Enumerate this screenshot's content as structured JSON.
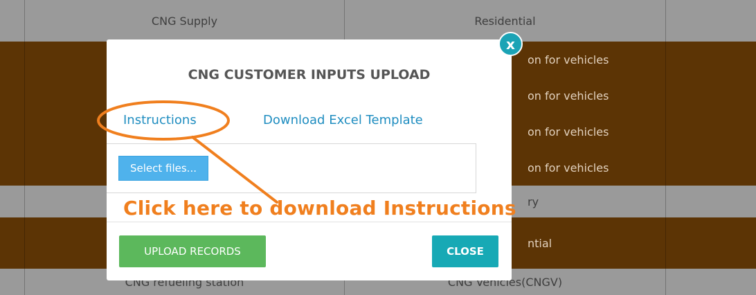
{
  "background_table": {
    "row1": {
      "col1": "CNG Supply",
      "col2": "Residential"
    },
    "row2": {
      "col2_lines": [
        "on for vehicles",
        "on for vehicles",
        "on for vehicles",
        "on for vehicles"
      ]
    },
    "row3": {
      "col2": "ry"
    },
    "row4": {
      "col2": "ntial"
    },
    "row5": {
      "col1": "CNG refueling station",
      "col2": "CNG Vehicles(CNGV)"
    }
  },
  "modal": {
    "title": "CNG CUSTOMER INPUTS UPLOAD",
    "instructions_link": "Instructions",
    "download_link": "Download Excel Template",
    "select_files_label": "Select files...",
    "upload_button": "UPLOAD RECORDS",
    "close_button": "CLOSE",
    "close_x": "x"
  },
  "annotation": {
    "text": "Click here to download Instructions",
    "color": "#f07f1e"
  },
  "colors": {
    "row_brown": "#5c3405",
    "row_grey": "#9a9a9a",
    "link": "#1f8dc0",
    "select_files": "#4fb2ec",
    "upload": "#5cb85c",
    "close": "#17a9b5"
  }
}
